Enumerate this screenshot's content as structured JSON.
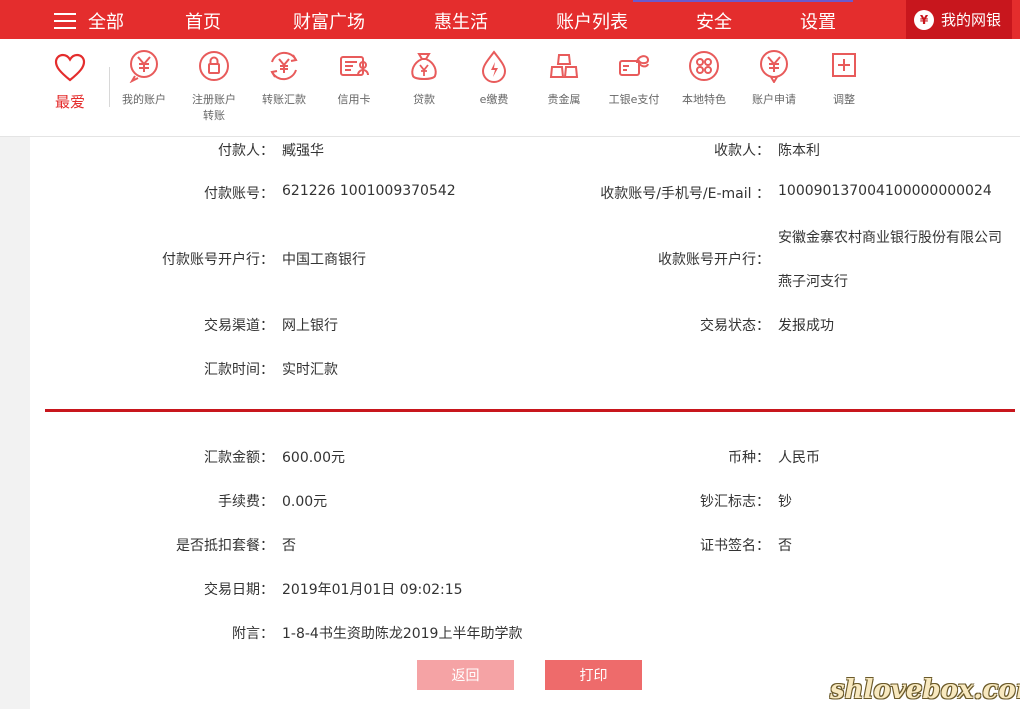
{
  "topnav": {
    "menu_label": "全部",
    "links": [
      "首页",
      "财富广场",
      "惠生活",
      "账户列表",
      "安全",
      "设置"
    ],
    "my_bank": "我的网银"
  },
  "quickbar": {
    "fav_label": "最爱",
    "items": [
      {
        "label": "我的账户",
        "icon": "yen-circle-icon"
      },
      {
        "label": "注册账户转账",
        "icon": "register-transfer-icon"
      },
      {
        "label": "转账汇款",
        "icon": "transfer-icon"
      },
      {
        "label": "信用卡",
        "icon": "credit-card-icon"
      },
      {
        "label": "贷款",
        "icon": "money-bag-icon"
      },
      {
        "label": "e缴费",
        "icon": "flame-icon"
      },
      {
        "label": "贵金属",
        "icon": "gold-bars-icon"
      },
      {
        "label": "工银e支付",
        "icon": "epay-icon"
      },
      {
        "label": "本地特色",
        "icon": "local-icon"
      },
      {
        "label": "账户申请",
        "icon": "account-apply-icon"
      },
      {
        "label": "调整",
        "icon": "plus-square-icon"
      }
    ]
  },
  "detail": {
    "payer_label": "付款人：",
    "payer": "臧强华",
    "payee_label": "收款人：",
    "payee": "陈本利",
    "payer_account_label": "付款账号：",
    "payer_account": "621226 1001009370542",
    "payee_account_label": "收款账号/手机号/E-mail ：",
    "payee_account": "100090137004100000000024",
    "payer_bank_label": "付款账号开户行：",
    "payer_bank": "中国工商银行",
    "payee_bank_label": "收款账号开户行：",
    "payee_bank_line1": "安徽金寨农村商业银行股份有限公司",
    "payee_bank_line2": "燕子河支行",
    "channel_label": "交易渠道：",
    "channel": "网上银行",
    "status_label": "交易状态：",
    "status": "发报成功",
    "remit_time_label": "汇款时间：",
    "remit_time": "实时汇款",
    "amount_label": "汇款金额：",
    "amount": "600.00元",
    "currency_label": "币种：",
    "currency": "人民币",
    "fee_label": "手续费：",
    "fee": "0.00元",
    "cash_flag_label": "钞汇标志：",
    "cash_flag": "钞",
    "deduct_label": "是否抵扣套餐：",
    "deduct": "否",
    "cert_label": "证书签名：",
    "cert": "否",
    "date_label": "交易日期：",
    "date": "2019年01月01日 09:02:15",
    "memo_label": "附言：",
    "memo": "1-8-4书生资助陈龙2019上半年助学款"
  },
  "buttons": {
    "back": "返回",
    "print": "打印"
  },
  "watermark": "shlovebox.com",
  "colors": {
    "brand_red": "#e42d2d",
    "dark_red": "#c8161d",
    "back_button": "#f5a3a5",
    "print_button": "#ee6b6b"
  }
}
